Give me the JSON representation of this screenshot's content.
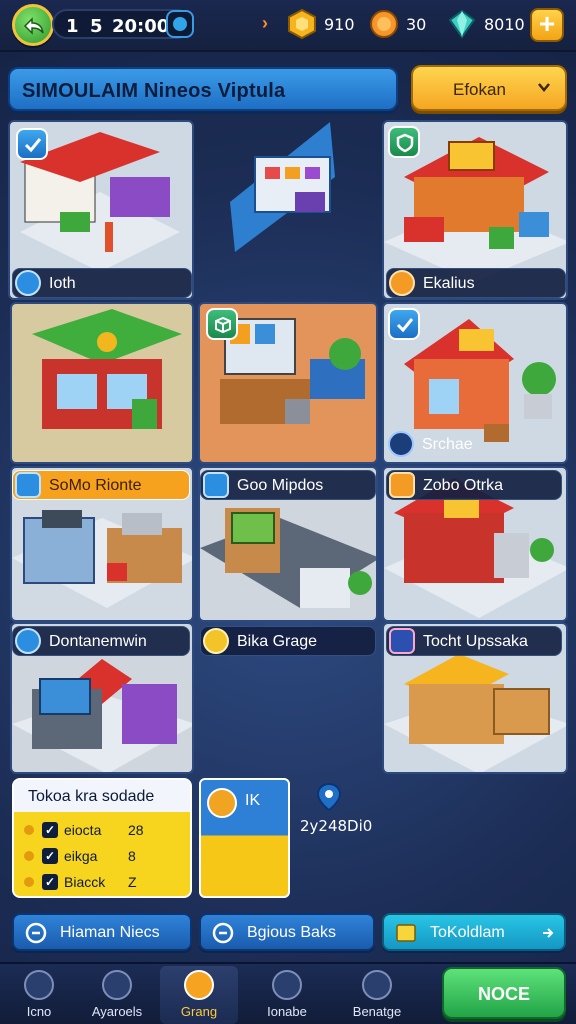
{
  "topbar": {
    "timer": {
      "a": "1",
      "b": "5",
      "c": "20:00"
    },
    "resources": [
      {
        "name": "gold",
        "icon": "gold-hexagon-icon",
        "value": "910"
      },
      {
        "name": "cookie",
        "icon": "coin-icon",
        "value": "30"
      },
      {
        "name": "gem",
        "icon": "gem-icon",
        "value": "8010"
      }
    ],
    "plus_label": "+"
  },
  "title": "SIMOULAIM Nineos Viptula",
  "dropdown": {
    "selected": "Efokan"
  },
  "tiles": {
    "t1": {
      "label": "Ioth"
    },
    "t3": {
      "label": "Ekalius"
    },
    "t6": {
      "label": "Srchae"
    },
    "t7": {
      "label": "SoMo Rionte"
    },
    "t8": {
      "label": "Goo Mipdos"
    },
    "t9": {
      "label": "Zobo Otrka"
    },
    "t10": {
      "label": "Dontanemwin"
    },
    "t11": {
      "label": "Bika Grage"
    },
    "t12": {
      "label": "Tocht Upssaka"
    }
  },
  "tasks": {
    "title": "Tokoa kra sodade",
    "rows": [
      {
        "name": "eiocta",
        "value": "28"
      },
      {
        "name": "eikga",
        "value": "8"
      },
      {
        "name": "Biacck",
        "value": "Z"
      }
    ]
  },
  "mid_card": {
    "label": "IK"
  },
  "stat_value": "2y248Di0",
  "actions": [
    {
      "label": "Hiaman Niecs"
    },
    {
      "label": "Bgious Baks"
    },
    {
      "label": "ToKoldlam"
    }
  ],
  "nav": [
    {
      "label": "Icno"
    },
    {
      "label": "Ayaroels"
    },
    {
      "label": "Grang"
    },
    {
      "label": "Ionabe"
    },
    {
      "label": "Benatge"
    }
  ],
  "cta_label": "NOCE",
  "colors": {
    "accent_yellow": "#f5a623",
    "accent_blue": "#2e7fd6",
    "accent_green": "#22a447",
    "bg": "#1b2a4e"
  }
}
